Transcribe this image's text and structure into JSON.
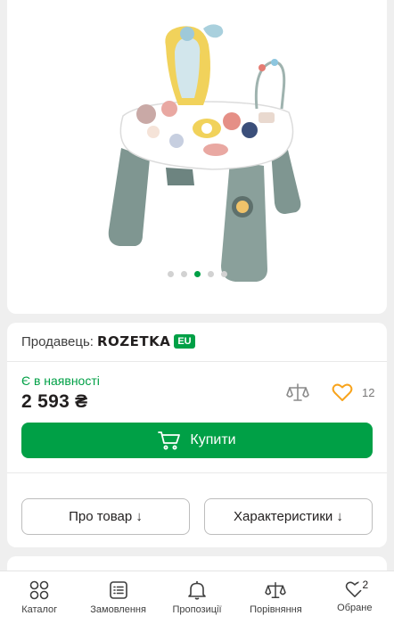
{
  "product": {
    "gallery_dot_count": 5,
    "gallery_active_index": 2
  },
  "seller": {
    "label": "Продавець:",
    "name": "ROZETKA",
    "tag": "EU"
  },
  "offer": {
    "stock_status": "Є в наявності",
    "price": "2 593 ₴",
    "favorites_count": "12",
    "buy_label": "Купити"
  },
  "tabs": {
    "about_label": "Про товар ↓",
    "characteristics_label": "Характеристики ↓"
  },
  "bottom_nav": {
    "items": [
      {
        "label": "Каталог",
        "icon": "grid-icon"
      },
      {
        "label": "Замовлення",
        "icon": "orders-icon"
      },
      {
        "label": "Пропозиції",
        "icon": "bell-icon"
      },
      {
        "label": "Порівняння",
        "icon": "scales-icon"
      },
      {
        "label": "Обране",
        "icon": "heart-icon",
        "badge": "2"
      }
    ]
  },
  "colors": {
    "accent": "#00a046",
    "favorite": "#f8a41d",
    "text": "#221f1f"
  }
}
